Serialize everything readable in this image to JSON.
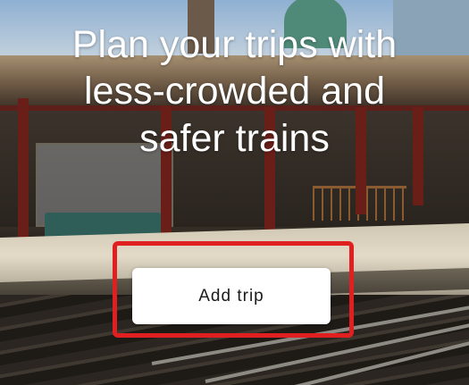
{
  "hero": {
    "headline_lines": [
      "Plan your trips with",
      "less-crowded and",
      "safer trains"
    ],
    "background_image": "train-station-platform-photo"
  },
  "cta": {
    "add_trip_label": "Add trip"
  },
  "annotation": {
    "highlight_color": "#e02020"
  },
  "colors": {
    "button_bg": "#ffffff",
    "headline_text": "#ffffff"
  }
}
